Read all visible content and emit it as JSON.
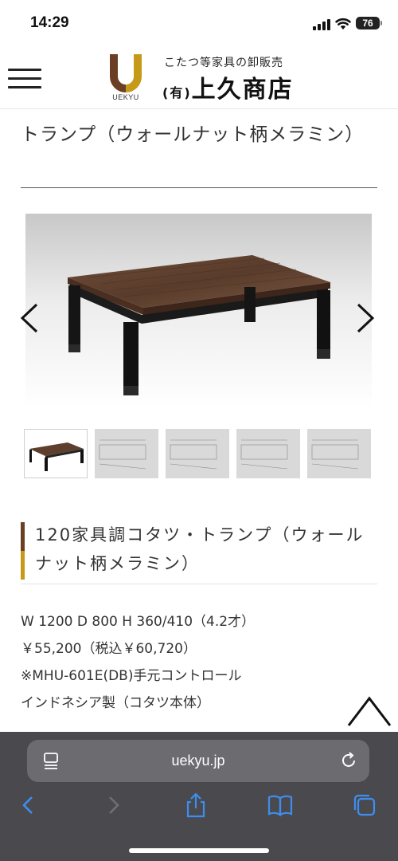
{
  "status_bar": {
    "time": "14:29",
    "battery": "76"
  },
  "header": {
    "logo_text": "UEKYU",
    "tagline": "こたつ等家具の卸販売",
    "shop_prefix": "(有)",
    "shop_name": "上久商店"
  },
  "page_title": "トランプ（ウォールナット柄メラミン）",
  "gallery": {
    "thumbnail_count": 5,
    "active_index": 0
  },
  "product": {
    "heading": "120家具調コタツ・トランプ（ウォールナット柄メラミン）",
    "specs": [
      "W 1200 D 800 H 360/410（4.2才）",
      "￥55,200（税込￥60,720）",
      "※MHU-601E(DB)手元コントロール",
      "インドネシア製（コタツ本体）"
    ]
  },
  "browser": {
    "url": "uekyu.jp"
  },
  "colors": {
    "accent_brown": "#6b3f24",
    "accent_gold": "#c69a18",
    "toolbar_blue": "#3d8ef0"
  }
}
